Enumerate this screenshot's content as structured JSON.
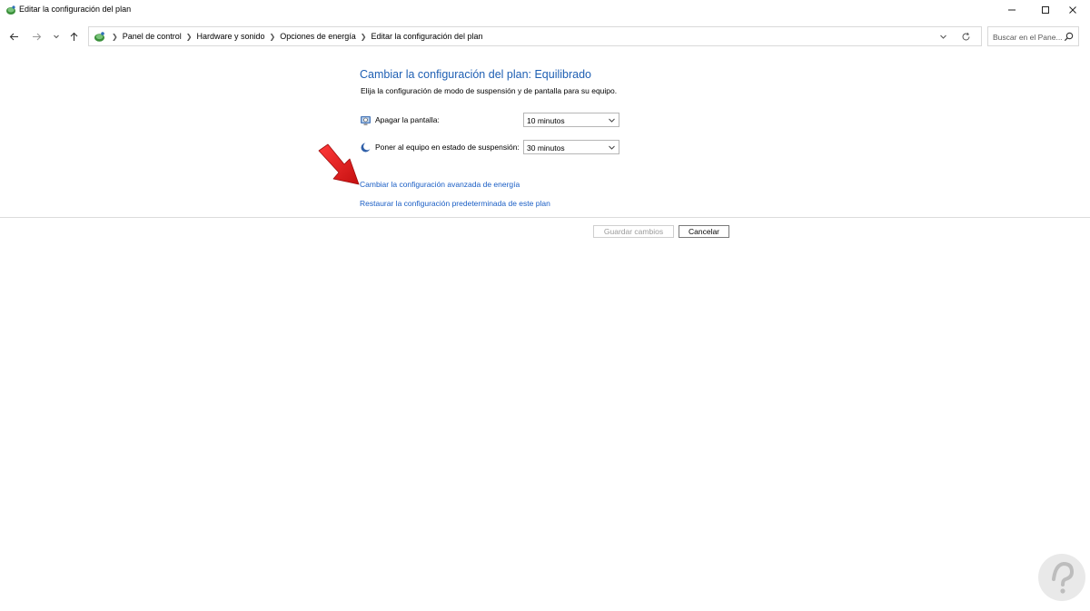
{
  "window": {
    "title": "Editar la configuración del plan"
  },
  "nav": {
    "breadcrumbs": [
      "Panel de control",
      "Hardware y sonido",
      "Opciones de energía",
      "Editar la configuración del plan"
    ],
    "search_placeholder": "Buscar en el Pane..."
  },
  "main": {
    "title": "Cambiar la configuración del plan: Equilibrado",
    "subtitle": "Elija la configuración de modo de suspensión y de pantalla para su equipo.",
    "settings": [
      {
        "label": "Apagar la pantalla:",
        "value": "10 minutos",
        "icon": "monitor-icon"
      },
      {
        "label": "Poner al equipo en estado de suspensión:",
        "value": "30 minutos",
        "icon": "moon-icon"
      }
    ],
    "links": {
      "advanced": "Cambiar la configuración avanzada de energía",
      "restore": "Restaurar la configuración predeterminada de este plan"
    }
  },
  "buttons": {
    "save": "Guardar cambios",
    "cancel": "Cancelar"
  },
  "colors": {
    "title_blue": "#1e5fb3",
    "link_blue": "#1a5ec5",
    "annotation_arrow": "#e41b1b"
  }
}
